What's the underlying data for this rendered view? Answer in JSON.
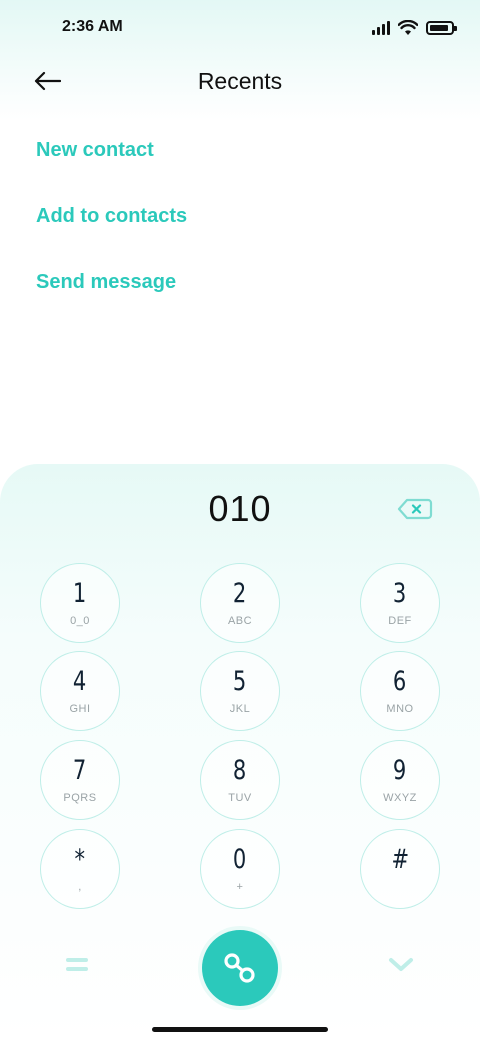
{
  "status_bar": {
    "time": "2:36 AM",
    "icons": [
      "signal-icon",
      "wifi-icon",
      "battery-icon"
    ]
  },
  "header": {
    "title": "Recents",
    "back_icon": "arrow-left-icon"
  },
  "options": {
    "new_contact": "New contact",
    "add_to_contacts": "Add to contacts",
    "send_message": "Send message"
  },
  "dialer": {
    "number": "010",
    "backspace_icon": "backspace-icon",
    "keys": [
      {
        "digit": "1",
        "letters": "0_0"
      },
      {
        "digit": "2",
        "letters": "ABC"
      },
      {
        "digit": "3",
        "letters": "DEF"
      },
      {
        "digit": "4",
        "letters": "GHI"
      },
      {
        "digit": "5",
        "letters": "JKL"
      },
      {
        "digit": "6",
        "letters": "MNO"
      },
      {
        "digit": "7",
        "letters": "PQRS"
      },
      {
        "digit": "8",
        "letters": "TUV"
      },
      {
        "digit": "9",
        "letters": "WXYZ"
      },
      {
        "digit": "*",
        "letters": ","
      },
      {
        "digit": "0",
        "letters": "+"
      },
      {
        "digit": "#",
        "letters": ""
      }
    ],
    "menu_icon": "equals-icon",
    "call_icon": "voicemail-icon",
    "collapse_icon": "chevron-down-icon"
  },
  "colors": {
    "accent": "#2bc9bb",
    "key_border": "#bfeee8",
    "header_tint": "#e3f8f5"
  }
}
